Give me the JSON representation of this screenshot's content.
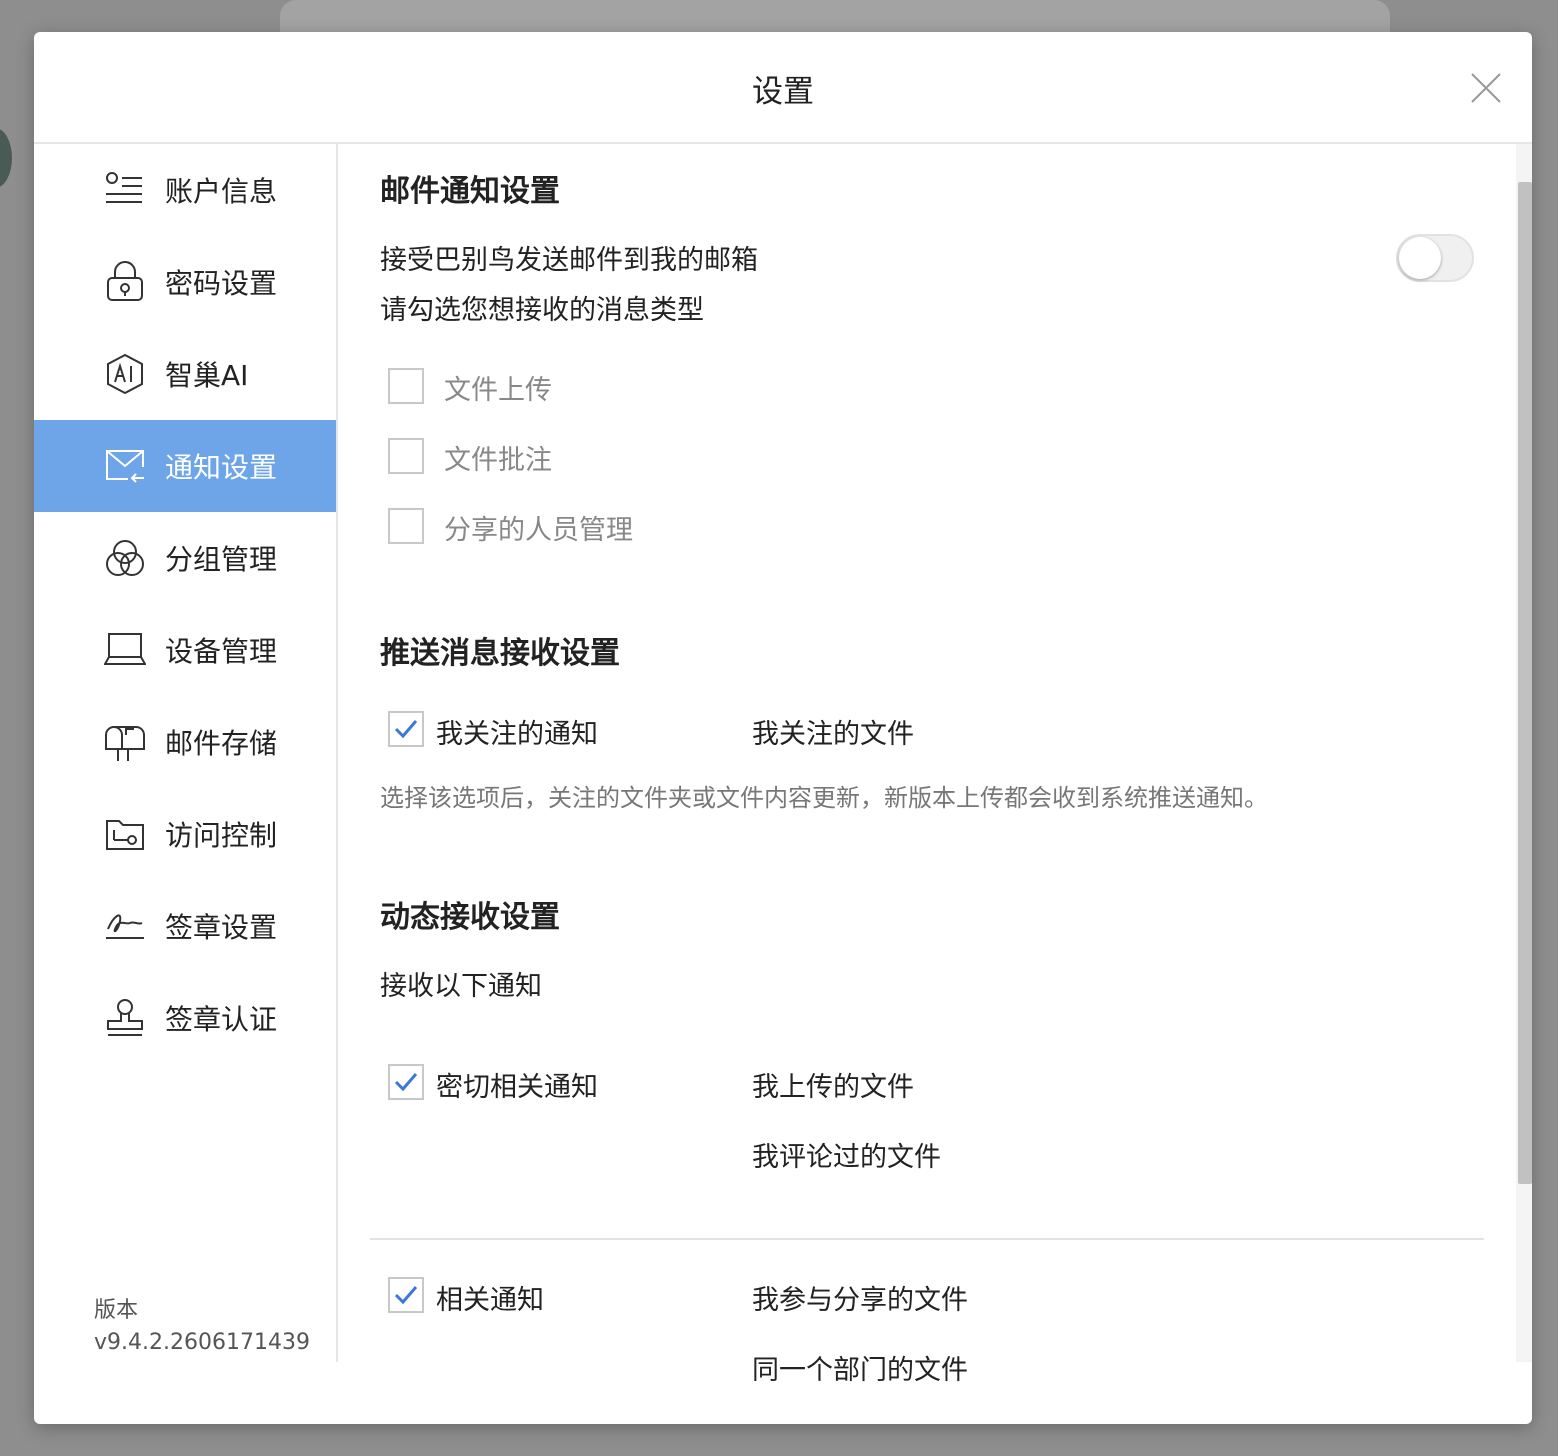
{
  "dialog": {
    "title": "设置"
  },
  "sidebar": {
    "items": [
      {
        "label": "账户信息",
        "icon": "account-info-icon"
      },
      {
        "label": "密码设置",
        "icon": "lock-icon"
      },
      {
        "label": "智巢AI",
        "icon": "ai-hexagon-icon"
      },
      {
        "label": "通知设置",
        "icon": "mail-notification-icon"
      },
      {
        "label": "分组管理",
        "icon": "group-circles-icon"
      },
      {
        "label": "设备管理",
        "icon": "laptop-icon"
      },
      {
        "label": "邮件存储",
        "icon": "mailbox-icon"
      },
      {
        "label": "访问控制",
        "icon": "folder-key-icon"
      },
      {
        "label": "签章设置",
        "icon": "signature-icon"
      },
      {
        "label": "签章认证",
        "icon": "stamp-icon"
      }
    ],
    "active_index": 3,
    "version_label": "版本",
    "version_value": "v9.4.2.2606171439",
    "active_color": "#6ea5e9"
  },
  "email_section": {
    "title": "邮件通知设置",
    "accept_label": "接受巴别鸟发送邮件到我的邮箱",
    "accept_enabled": false,
    "types_prompt": "请勾选您想接收的消息类型",
    "types": [
      {
        "label": "文件上传",
        "checked": false
      },
      {
        "label": "文件批注",
        "checked": false
      },
      {
        "label": "分享的人员管理",
        "checked": false
      }
    ]
  },
  "push_section": {
    "title": "推送消息接收设置",
    "option_label": "我关注的通知",
    "option_checked": true,
    "scope": "我关注的文件",
    "hint": "选择该选项后，关注的文件夹或文件内容更新，新版本上传都会收到系统推送通知。"
  },
  "activity_section": {
    "title": "动态接收设置",
    "prompt": "接收以下通知",
    "close_label": "密切相关通知",
    "close_checked": true,
    "close_scopes": [
      "我上传的文件",
      "我评论过的文件"
    ],
    "related_label": "相关通知",
    "related_checked": true,
    "related_scopes": [
      "我参与分享的文件",
      "同一个部门的文件"
    ]
  },
  "colors": {
    "check_accent": "#3d78d8"
  }
}
